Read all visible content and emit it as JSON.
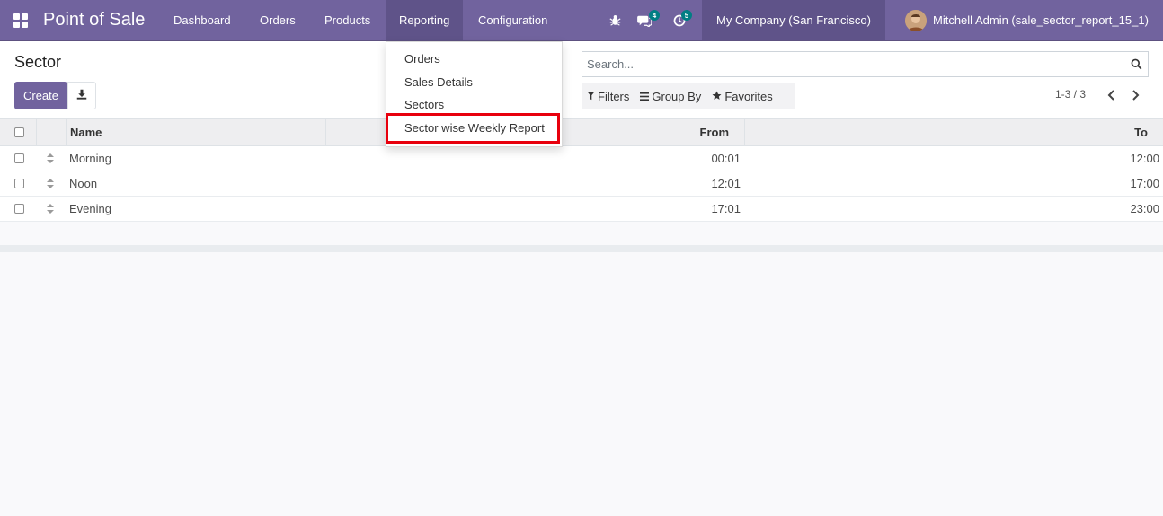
{
  "navbar": {
    "app_title": "Point of Sale",
    "menu": [
      "Dashboard",
      "Orders",
      "Products",
      "Reporting",
      "Configuration"
    ],
    "messages_count": "4",
    "activities_count": "5",
    "company": "My Company (San Francisco)",
    "user": "Mitchell Admin (sale_sector_report_15_1)"
  },
  "reporting_menu": {
    "items": [
      "Orders",
      "Sales Details",
      "Sectors",
      "Sector wise Weekly Report"
    ]
  },
  "control_panel": {
    "title": "Sector",
    "create_label": "Create",
    "search_placeholder": "Search...",
    "filters_label": "Filters",
    "groupby_label": "Group By",
    "favorites_label": "Favorites",
    "pager": "1-3 / 3"
  },
  "table": {
    "columns": [
      "Name",
      "From",
      "To"
    ],
    "rows": [
      {
        "name": "Morning",
        "from": "00:01",
        "to": "12:00"
      },
      {
        "name": "Noon",
        "from": "12:01",
        "to": "17:00"
      },
      {
        "name": "Evening",
        "from": "17:01",
        "to": "23:00"
      }
    ]
  },
  "colors": {
    "primary": "#71639e",
    "highlight_box": "#e8000d",
    "badge": "#017e84"
  }
}
